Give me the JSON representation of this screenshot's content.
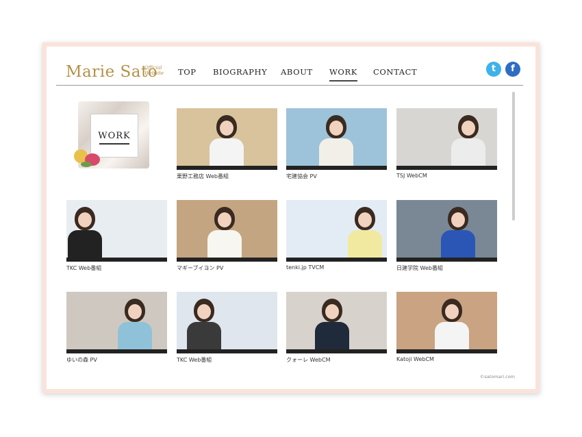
{
  "site": {
    "logo": "Marie Sato",
    "logo_sub": "Official Website"
  },
  "nav": [
    {
      "label": "TOP"
    },
    {
      "label": "BIOGRAPHY"
    },
    {
      "label": "ABOUT"
    },
    {
      "label": "WORK"
    },
    {
      "label": "CONTACT"
    }
  ],
  "social": {
    "twitter": "t",
    "facebook": "f"
  },
  "section": {
    "title": "WORK"
  },
  "works": [
    {
      "caption": "栗野工務店 Web番組",
      "bg": "#d9c39c"
    },
    {
      "caption": "宅建協会 PV",
      "bg": "#9cc3d9"
    },
    {
      "caption": "TSJ WebCM",
      "bg": "#d8d6d2"
    },
    {
      "caption": "TKC Web番組",
      "bg": "#e8edf2"
    },
    {
      "caption": "マギーブイヨン PV",
      "bg": "#c4a582"
    },
    {
      "caption": "tenki.jp TVCM",
      "bg": "#e3ecf4"
    },
    {
      "caption": "日建学院 Web番組",
      "bg": "#7a8896"
    },
    {
      "caption": "ゆいの森 PV",
      "bg": "#cfc8c0"
    },
    {
      "caption": "TKC Web番組",
      "bg": "#dfe6ee"
    },
    {
      "caption": "クォーレ WebCM",
      "bg": "#d7d3cc"
    },
    {
      "caption": "Katoji WebCM",
      "bg": "#c9a382"
    }
  ],
  "copyright": "©satomari.com",
  "colors": {
    "brand": "#b59048",
    "twitter": "#3eb2ea",
    "facebook": "#2f6cc3",
    "frame": "#fbe3db"
  }
}
